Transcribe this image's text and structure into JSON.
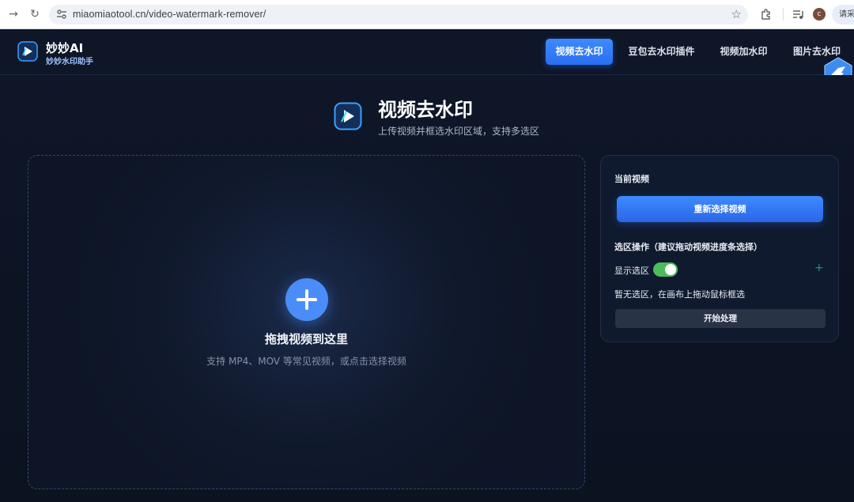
{
  "browser": {
    "url": "miaomiaotool.cn/video-watermark-remover/",
    "profile_initial": "c",
    "side_pill": "请采"
  },
  "header": {
    "brand_name": "妙妙AI",
    "brand_sub": "妙妙水印助手",
    "nav": [
      {
        "label": "视频去水印",
        "active": true
      },
      {
        "label": "豆包去水印插件",
        "active": false
      },
      {
        "label": "视频加水印",
        "active": false
      },
      {
        "label": "图片去水印",
        "active": false
      }
    ]
  },
  "page": {
    "title": "视频去水印",
    "subtitle": "上传视频并框选水印区域，支持多选区"
  },
  "dropzone": {
    "title": "拖拽视频到这里",
    "subtitle": "支持 MP4、MOV 等常见视频，或点击选择视频"
  },
  "panel": {
    "current_label": "当前视频",
    "reselect_label": "重新选择视频",
    "ops_label": "选区操作（建议拖动视频进度条选择）",
    "toggle_label": "显示选区",
    "toggle_on": true,
    "add_symbol": "+",
    "hint": "暂无选区，在画布上拖动鼠标框选",
    "start_label": "开始处理"
  },
  "colors": {
    "accent": "#3d8bff",
    "toggle_on": "#4cbb5b",
    "background": "#0b1220"
  }
}
